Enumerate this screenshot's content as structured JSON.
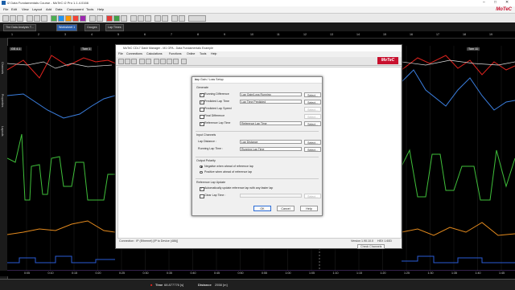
{
  "app": {
    "title": "i2 Data Fundamentals Course - MoTeC i2 Pro 1.1.4.0166",
    "window_controls": [
      "–",
      "□",
      "✕"
    ]
  },
  "menubar": {
    "items": [
      "File",
      "Edit",
      "View",
      "Layout",
      "Add",
      "Data",
      "Component",
      "Tools",
      "Help"
    ]
  },
  "logo": "MoTeC",
  "tabs": [
    {
      "label": "The Data Analysis T..."
    },
    {
      "label": "Worksheet 1"
    },
    {
      "label": "Gauges"
    },
    {
      "label": "Lap Times"
    }
  ],
  "ruler_ticks": [
    "1",
    "2",
    "3",
    "4",
    "5",
    "6",
    "7",
    "8",
    "9",
    "10",
    "11",
    "12",
    "13",
    "14",
    "15",
    "16",
    "17",
    "18",
    "19"
  ],
  "sidebar_labels": [
    "Channels",
    "Properties",
    "Layouts"
  ],
  "graph_labels": {
    "left": "GS 4.1",
    "center": "Turn 1",
    "right": "Turn 11"
  },
  "time_ticks": [
    "0:05",
    "0:10",
    "0:15",
    "0:20",
    "0:25",
    "0:30",
    "0:35",
    "0:40",
    "0:45",
    "0:50",
    "0:55",
    "1:00",
    "1:05",
    "1:10",
    "1:15",
    "1:20",
    "1:25",
    "1:30",
    "1:35",
    "1:40",
    "1:45"
  ],
  "statusbar": {
    "time_label": "Time",
    "time_value": "68.877776 [s]",
    "distance_label": "Distance",
    "distance_value": "2558 [m]"
  },
  "mcs": {
    "title": "MoTeC CDL7 Dash Manager - M1 GPA - Data Fundamentals Example",
    "menu": [
      "File",
      "Connections",
      "Calculations",
      "Functions",
      "Online",
      "Tools",
      "Help"
    ],
    "logo": "MoTeC",
    "status_left": "Connection : IP (Ethernet) [IP to Device (486)]",
    "status_right": "Version 1.90.10.0",
    "status_right2": "HEX 1.60D",
    "check_channels": "Check Channels"
  },
  "dialog": {
    "title": "Lap Gain / Loss Setup",
    "close": "✕",
    "generate_header": "Generate",
    "generate": [
      {
        "label": "Running Difference",
        "checked": true,
        "field": "Lap Gain/Loss Running",
        "select": "Select...",
        "enabled": true
      },
      {
        "label": "Predicted Lap Time",
        "checked": true,
        "field": "Lap Time Predicted",
        "select": "Select...",
        "enabled": true
      },
      {
        "label": "Predicted Lap Speed",
        "checked": false,
        "field": "",
        "select": "Select...",
        "enabled": false
      },
      {
        "label": "Final Difference",
        "checked": false,
        "field": "",
        "select": "Select...",
        "enabled": false
      },
      {
        "label": "Reference Lap Time",
        "checked": true,
        "field": "Reference Lap Time",
        "select": "Select...",
        "enabled": true
      }
    ],
    "input_header": "Input Channels",
    "inputs": [
      {
        "label": "Lap Distance :",
        "field": "Lap Distance",
        "select": "Select..."
      },
      {
        "label": "Running Lap Time :",
        "field": "Running Lap Time",
        "select": "Select..."
      }
    ],
    "polarity_header": "Output Polarity",
    "polarity": [
      {
        "label": "Negative when ahead of reference lap",
        "selected": true
      },
      {
        "label": "Positive when ahead of reference lap",
        "selected": false
      }
    ],
    "ref_header": "Reference Lap Update",
    "auto_update": {
      "label": "Automatically update reference lap with any faster lap",
      "checked": true
    },
    "clear_lap": {
      "label": "Clear Lap Time :",
      "checked": false,
      "select": "Select..."
    },
    "buttons": {
      "ok": "OK",
      "cancel": "Cancel",
      "help": "Help"
    }
  },
  "colors": {
    "red": "#e0231e",
    "blue": "#3b7fe0",
    "green": "#3fbf3a",
    "orange": "#e58b1e",
    "bluedark": "#2a5bd6",
    "purple": "#8a5cc9"
  }
}
